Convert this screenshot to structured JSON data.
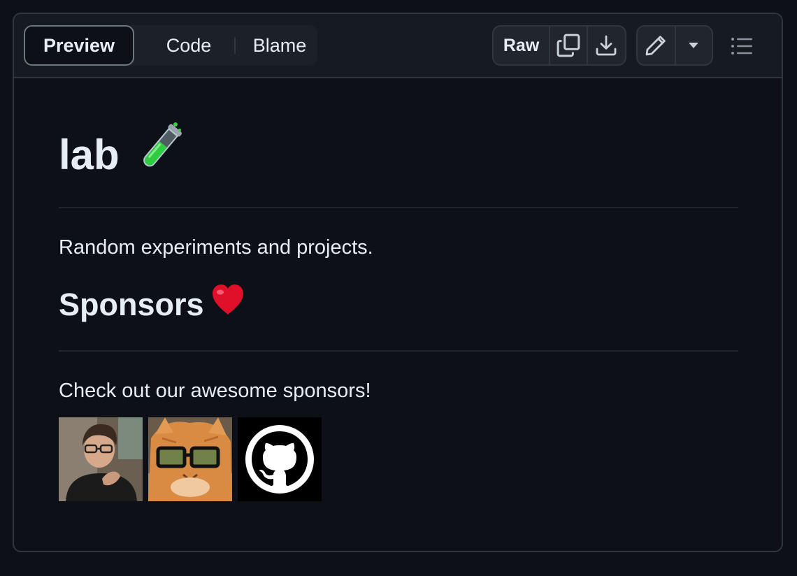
{
  "toolbar": {
    "tabs": [
      {
        "label": "Preview",
        "active": true
      },
      {
        "label": "Code",
        "active": false
      },
      {
        "label": "Blame",
        "active": false
      }
    ],
    "raw_label": "Raw",
    "icons": [
      "copy-icon",
      "download-icon",
      "pencil-icon",
      "triangle-down-icon",
      "list-unordered-icon"
    ]
  },
  "readme": {
    "title": "lab",
    "title_emoji": "test-tube",
    "description": "Random experiments and projects.",
    "sponsors_heading": "Sponsors",
    "sponsors_emoji": "heart",
    "sponsors_text": "Check out our awesome sponsors!",
    "sponsors": [
      {
        "kind": "person-avatar"
      },
      {
        "kind": "cat-avatar"
      },
      {
        "kind": "github-avatar"
      }
    ]
  },
  "colors": {
    "background": "#0d1117",
    "toolbar": "#161b22",
    "border": "#30363d",
    "text": "#e6edf3"
  }
}
